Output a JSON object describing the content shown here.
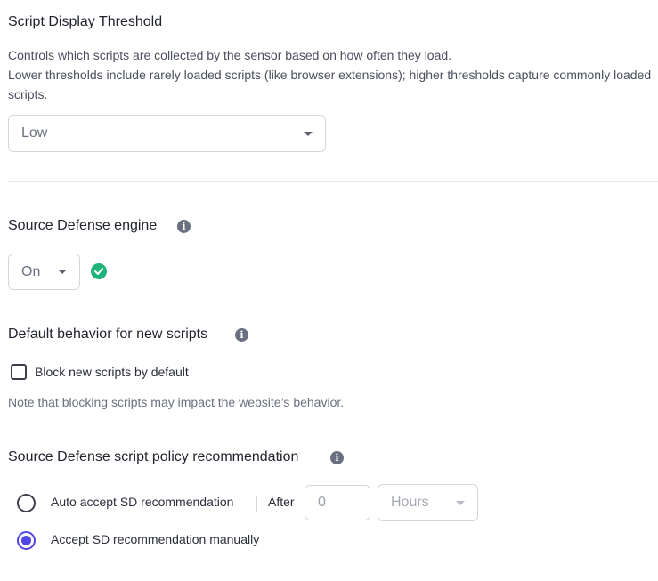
{
  "threshold": {
    "title": "Script Display Threshold",
    "desc_line1": "Controls which scripts are collected by the sensor based on how often they load.",
    "desc_line2": "Lower thresholds include rarely loaded scripts (like browser extensions); higher thresholds capture commonly loaded scripts.",
    "selected": "Low"
  },
  "engine": {
    "title": "Source Defense engine",
    "selected": "On",
    "status_icon": "check-circle-icon",
    "status_color": "#1fb37a"
  },
  "default_behavior": {
    "title": "Default behavior for new scripts",
    "checkbox_label": "Block new scripts by default",
    "checked": false,
    "note": "Note that blocking scripts may impact the website’s behavior."
  },
  "policy": {
    "title": "Source Defense script policy recommendation",
    "auto_label": "Auto accept SD recommendation",
    "after_label": "After",
    "after_placeholder": "0",
    "unit_selected": "Hours",
    "manual_label": "Accept SD recommendation manually",
    "selected_option": "manual",
    "accent_color": "#4f46e5"
  }
}
